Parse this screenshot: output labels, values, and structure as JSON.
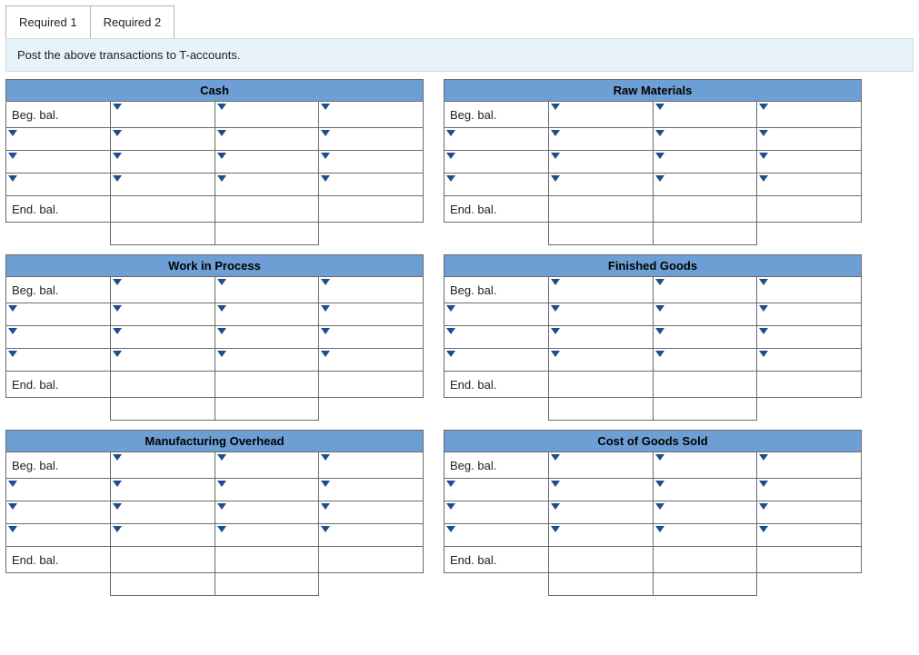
{
  "tabs": {
    "t1": "Required 1",
    "t2": "Required 2"
  },
  "instruction": "Post the above transactions to T-accounts.",
  "labels": {
    "beg": "Beg. bal.",
    "end": "End. bal."
  },
  "accounts": [
    {
      "title": "Cash"
    },
    {
      "title": "Raw Materials"
    },
    {
      "title": "Work in Process"
    },
    {
      "title": "Finished Goods"
    },
    {
      "title": "Manufacturing Overhead"
    },
    {
      "title": "Cost of Goods Sold"
    }
  ]
}
